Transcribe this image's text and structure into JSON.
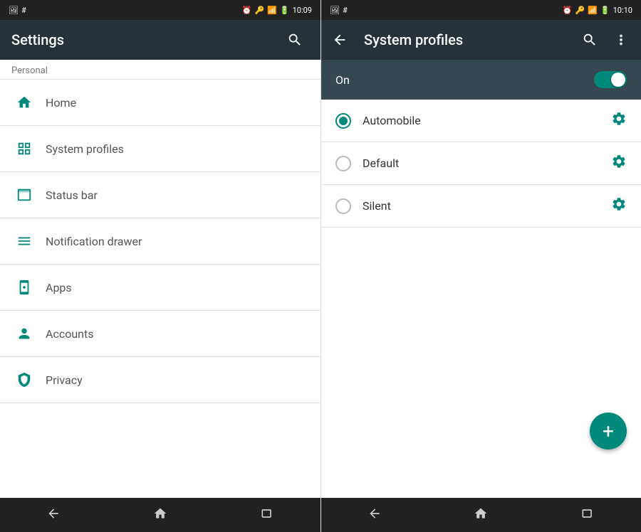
{
  "left": {
    "status_bar": {
      "time": "10:09",
      "icons": [
        "image",
        "#",
        "alarm",
        "key",
        "signal",
        "battery"
      ]
    },
    "app_bar": {
      "title": "Settings",
      "search_hint": "search"
    },
    "section_label": "Personal",
    "menu_items": [
      {
        "id": "home",
        "label": "Home",
        "icon": "🏠"
      },
      {
        "id": "system-profiles",
        "label": "System profiles",
        "icon": "⊞"
      },
      {
        "id": "status-bar",
        "label": "Status bar",
        "icon": "☐"
      },
      {
        "id": "notification-drawer",
        "label": "Notification drawer",
        "icon": "☰"
      },
      {
        "id": "apps",
        "label": "Apps",
        "icon": "🤖"
      },
      {
        "id": "accounts",
        "label": "Accounts",
        "icon": "👤"
      },
      {
        "id": "privacy",
        "label": "Privacy",
        "icon": "🛡"
      }
    ],
    "nav": {
      "back": "❮❮",
      "home": "⌂",
      "recents": "☐"
    }
  },
  "right": {
    "status_bar": {
      "time": "10:10",
      "icons": [
        "image",
        "#",
        "alarm",
        "key",
        "signal",
        "battery"
      ]
    },
    "app_bar": {
      "title": "System profiles",
      "back_label": "←",
      "search_label": "search",
      "more_label": "⋮"
    },
    "toggle": {
      "label": "On",
      "enabled": true
    },
    "profiles": [
      {
        "id": "automobile",
        "label": "Automobile",
        "selected": true
      },
      {
        "id": "default",
        "label": "Default",
        "selected": false
      },
      {
        "id": "silent",
        "label": "Silent",
        "selected": false
      }
    ],
    "fab_label": "+",
    "nav": {
      "back": "❮❮",
      "home": "⌂",
      "recents": "☐"
    }
  }
}
